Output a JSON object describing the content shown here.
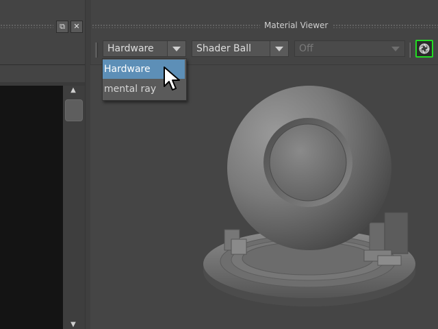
{
  "left_panel": {
    "float_icon": "float-window-icon",
    "close_icon": "close-icon"
  },
  "material_viewer": {
    "title": "Material Viewer",
    "renderer": {
      "selected": "Hardware",
      "options": [
        "Hardware",
        "mental ray"
      ]
    },
    "shader": {
      "selected": "Shader Ball"
    },
    "lighting": {
      "selected": "Off",
      "disabled": true
    },
    "render_button_icon": "render-camera-icon",
    "accent_color": "#22dd22",
    "highlight_color": "#5d8fb7"
  },
  "preview": {
    "object": "shader-ball"
  }
}
